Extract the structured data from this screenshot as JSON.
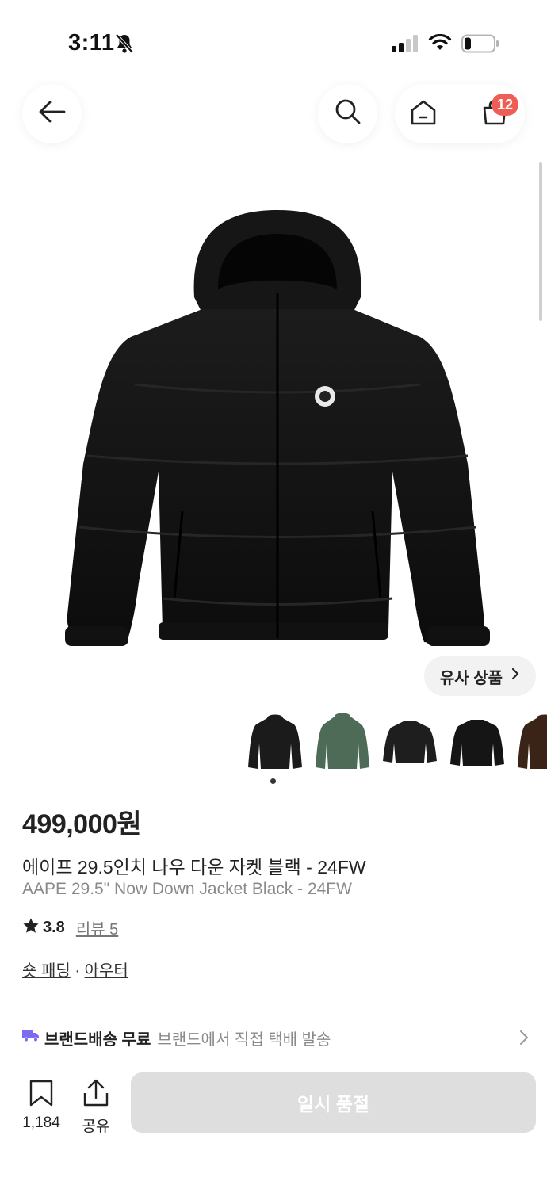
{
  "status_bar": {
    "time": "3:11"
  },
  "header": {
    "cart_count": "12"
  },
  "similar_button": {
    "label": "유사 상품",
    "chevron": "›"
  },
  "thumbnails": [
    {
      "color": "#1b1b1b"
    },
    {
      "color": "#4e6b58"
    },
    {
      "color": "#1e1e1e"
    },
    {
      "color": "#151515"
    },
    {
      "color": "#3a2418"
    }
  ],
  "product": {
    "price": "499,000원",
    "title_ko": "에이프 29.5인치 나우 다운 자켓 블랙 - 24FW",
    "title_en": "AAPE 29.5\" Now Down Jacket Black - 24FW",
    "rating": "3.8",
    "reviews_label": "리뷰 5",
    "category_1": "숏 패딩",
    "category_sep": " · ",
    "category_2": "아우터"
  },
  "delivery": {
    "title": "브랜드배송 무료",
    "description": "브랜드에서 직접 택배 발송"
  },
  "bottom_bar": {
    "bookmark_count": "1,184",
    "share_label": "공유",
    "soldout_label": "일시 품절"
  },
  "colors": {
    "badge": "#ef5e55",
    "delivery_icon": "#7b6cf2",
    "soldout_bg": "#dedede"
  }
}
